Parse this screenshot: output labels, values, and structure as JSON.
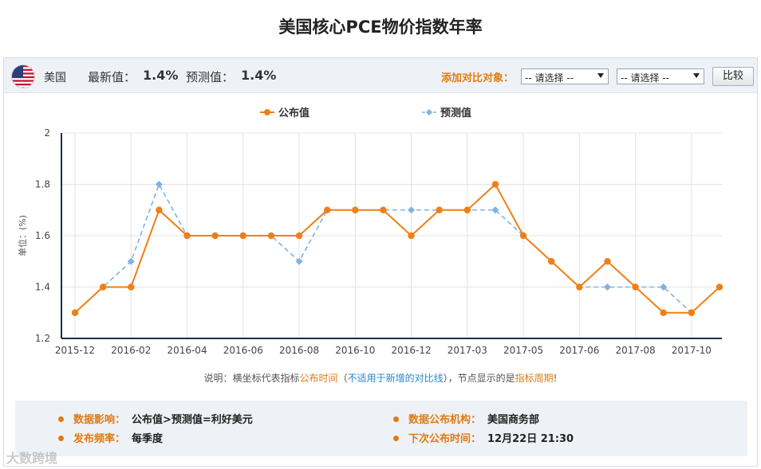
{
  "page": {
    "title": "美国核心PCE物价指数年率"
  },
  "header": {
    "country": "美国",
    "flag_icon": "us-flag-icon",
    "latest_label": "最新值：",
    "latest_value": "1.4%",
    "forecast_label": "预测值：",
    "forecast_value": "1.4%",
    "compare_label": "添加对比对象：",
    "select1_value": "-- 请选择 --",
    "select2_value": "-- 请选择 --",
    "compare_button": "比较"
  },
  "chart_data": {
    "type": "line",
    "title": "",
    "xlabel": "",
    "ylabel": "单位：(%)",
    "ylim": [
      1.2,
      2
    ],
    "yticks": [
      "1.2",
      "1.4",
      "1.6",
      "1.8",
      "2"
    ],
    "x": [
      "2015-12",
      "2016-01",
      "2016-02",
      "2016-03",
      "2016-04",
      "2016-05",
      "2016-06",
      "2016-07",
      "2016-08",
      "2016-09",
      "2016-10",
      "2016-11",
      "2016-12",
      "2017-01",
      "2017-03",
      "2017-04",
      "2017-05",
      "2017-05b",
      "2017-06",
      "2017-07",
      "2017-08",
      "2017-09",
      "2017-10",
      "2017-11"
    ],
    "xtick_labels": [
      {
        "index": 0,
        "label": "2015-12"
      },
      {
        "index": 2,
        "label": "2016-02"
      },
      {
        "index": 4,
        "label": "2016-04"
      },
      {
        "index": 6,
        "label": "2016-06"
      },
      {
        "index": 8,
        "label": "2016-08"
      },
      {
        "index": 10,
        "label": "2016-10"
      },
      {
        "index": 12,
        "label": "2016-12"
      },
      {
        "index": 14,
        "label": "2017-03"
      },
      {
        "index": 16,
        "label": "2017-05"
      },
      {
        "index": 18,
        "label": "2017-06"
      },
      {
        "index": 20,
        "label": "2017-08"
      },
      {
        "index": 22,
        "label": "2017-10"
      }
    ],
    "series": [
      {
        "name": "公布值",
        "color": "#f07f15",
        "style": "solid",
        "values": [
          1.3,
          1.4,
          1.4,
          1.7,
          1.6,
          1.6,
          1.6,
          1.6,
          1.6,
          1.7,
          1.7,
          1.7,
          1.6,
          1.7,
          1.7,
          1.8,
          1.6,
          1.5,
          1.4,
          1.5,
          1.4,
          1.3,
          1.3,
          1.4
        ]
      },
      {
        "name": "预测值",
        "color": "#7fb3e3",
        "style": "dashed",
        "values": [
          1.3,
          1.4,
          1.5,
          1.8,
          1.6,
          1.6,
          1.6,
          1.6,
          1.5,
          1.7,
          1.7,
          1.7,
          1.7,
          1.7,
          1.7,
          1.7,
          1.6,
          1.5,
          1.4,
          1.4,
          1.4,
          1.4,
          1.3,
          1.4
        ]
      }
    ],
    "grid": true,
    "legend": "top-center"
  },
  "note": {
    "prefix": "说明：横坐标代表指标",
    "highlight1": "公布时间",
    "paren_open": "（",
    "blue_text": "不适用于新增的对比线",
    "paren_close": "）",
    "middle": "，节点显示的是",
    "highlight2": "指标周期",
    "suffix": "!"
  },
  "info": {
    "impact_label": "数据影响：",
    "impact_value": "公布值>预测值=利好美元",
    "agency_label": "数据公布机构：",
    "agency_value": "美国商务部",
    "freq_label": "发布频率：",
    "freq_value": "每季度",
    "next_label": "下次公布时间：",
    "next_value": "12月22日 21:30"
  },
  "watermark": "大数跨境"
}
